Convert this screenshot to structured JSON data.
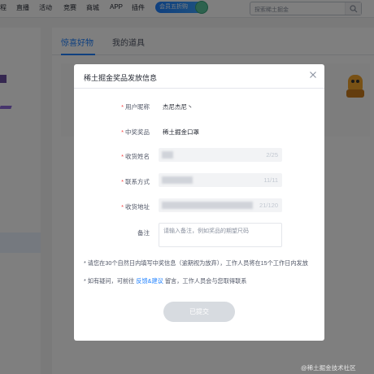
{
  "topnav": {
    "items": [
      "程",
      "直播",
      "活动",
      "竞赛",
      "商城",
      "APP",
      "插件"
    ],
    "vip_label": "会员五折购",
    "search_placeholder": "探索稀土掘金"
  },
  "main": {
    "tabs": [
      {
        "label": "惊喜好物",
        "active": true
      },
      {
        "label": "我的道具",
        "active": false
      }
    ]
  },
  "dialog": {
    "title": "稀土掘金奖品发放信息",
    "fields": {
      "username": {
        "label": "用户昵称",
        "value": "杰尼杰尼丶"
      },
      "prize": {
        "label": "中奖奖品",
        "value": "稀土掘金口罩"
      },
      "receiver": {
        "label": "收货姓名",
        "count": "2/25"
      },
      "phone": {
        "label": "联系方式",
        "count": "11/11"
      },
      "address": {
        "label": "收货地址",
        "count": "21/120"
      },
      "remark": {
        "label": "备注",
        "placeholder": "请输入备注，例如奖品的期望尺码"
      }
    },
    "note1": "* 请您在30个自然日内填写中奖信息（逾期视为放弃），工作人员将在15个工作日内发放",
    "note2_prefix": "* 如有疑问，可前往",
    "note2_link": "反馈&建议",
    "note2_suffix": "留言，工作人员会与您取得联系",
    "submit_label": "已提交"
  },
  "watermark": "@稀土掘金技术社区",
  "colors": {
    "accent": "#1e80ff",
    "required_star": "#f53f3f",
    "submit_disabled": "#d7dbe0"
  }
}
